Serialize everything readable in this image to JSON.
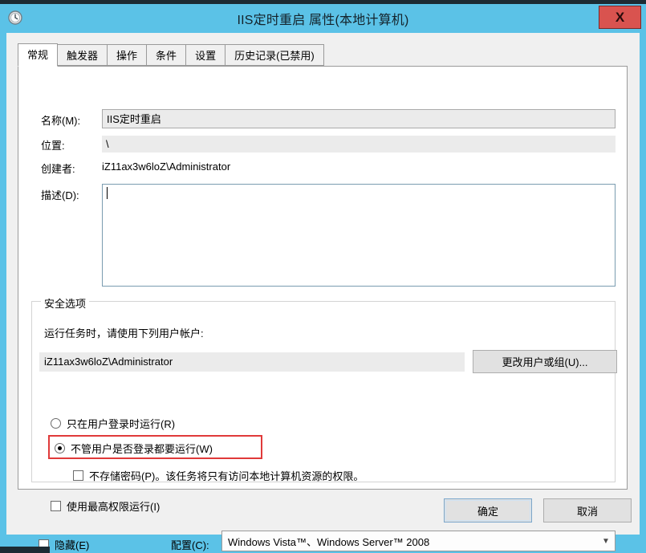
{
  "window": {
    "title": "IIS定时重启 属性(本地计算机)",
    "icon": "clock-icon",
    "close_label": "X",
    "titlebar_color": "#5bc2e7",
    "close_color": "#d9534f"
  },
  "tabs": [
    {
      "label": "常规",
      "active": true
    },
    {
      "label": "触发器",
      "active": false
    },
    {
      "label": "操作",
      "active": false
    },
    {
      "label": "条件",
      "active": false
    },
    {
      "label": "设置",
      "active": false
    },
    {
      "label": "历史记录(已禁用)",
      "active": false
    }
  ],
  "general": {
    "name_label": "名称(M):",
    "name_value": "IIS定时重启",
    "location_label": "位置:",
    "location_value": "\\",
    "author_label": "创建者:",
    "author_value": "iZ11ax3w6loZ\\Administrator",
    "description_label": "描述(D):",
    "description_value": "",
    "description_placeholder": ""
  },
  "security": {
    "group_title": "安全选项",
    "description": "运行任务时，请使用下列用户帐户:",
    "account_value": "iZ11ax3w6loZ\\Administrator",
    "change_user_label": "更改用户或组(U)...",
    "run_only_when_logged_on": {
      "label": "只在用户登录时运行(R)",
      "checked": false
    },
    "run_whether_logged_on": {
      "label": "不管用户是否登录都要运行(W)",
      "checked": true,
      "highlighted": true,
      "highlight_color": "#e03a3a"
    },
    "do_not_store_password": {
      "label": "不存储密码(P)。该任务将只有访问本地计算机资源的权限。",
      "checked": false
    },
    "run_with_highest_privileges": {
      "label": "使用最高权限运行(I)",
      "checked": false
    }
  },
  "bottom": {
    "hidden_label": "隐藏(E)",
    "hidden_checked": false,
    "configure_label": "配置(C):",
    "configure_value": "Windows Vista™、Windows Server™ 2008",
    "configure_arrow": "chevron-down-icon"
  },
  "footer": {
    "ok_label": "确定",
    "cancel_label": "取消"
  }
}
